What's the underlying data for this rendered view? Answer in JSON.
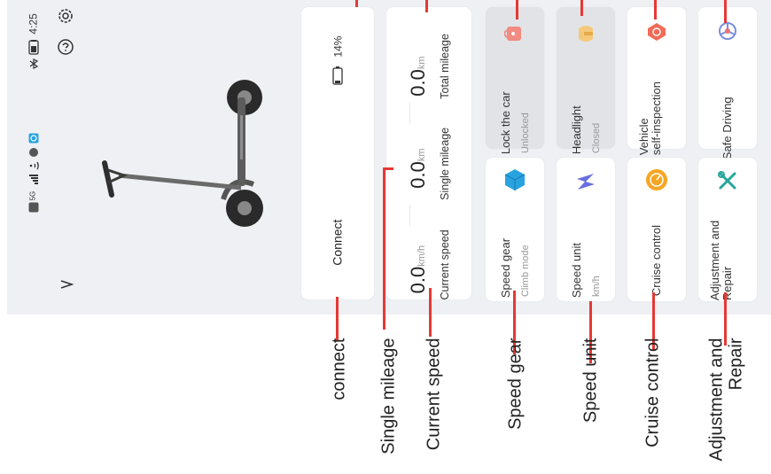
{
  "status_bar": {
    "time": "4:25",
    "network": "5G",
    "icons": [
      "bluetooth-icon",
      "battery-icon",
      "signal-icon",
      "wifi-icon",
      "notification-icon"
    ]
  },
  "header": {
    "icons": [
      "settings-gear-icon",
      "help-icon",
      "chevron-down-icon"
    ]
  },
  "scooter": {
    "image": "electric-scooter"
  },
  "connect_card": {
    "button_label": "Connect",
    "battery_percent": "14%",
    "battery_level": 0.14
  },
  "stats": {
    "total_mileage": {
      "value": "0.0",
      "unit": "km",
      "label": "Total mileage"
    },
    "single_mileage": {
      "value": "0.0",
      "unit": "km",
      "label": "Single mileage"
    },
    "current_speed": {
      "value": "0.0",
      "unit": "km/h",
      "label": "Current speed"
    }
  },
  "controls": {
    "lock": {
      "label": "Lock the car",
      "status": "Unlocked",
      "icon": "lock-icon"
    },
    "headlight": {
      "label": "Headlight",
      "status": "Closed",
      "icon": "headlight-icon"
    },
    "inspection": {
      "label": "Vehicle self-inspection",
      "line1": "Vehicle",
      "line2": "self-inspection",
      "icon": "inspection-icon"
    },
    "safe_driving": {
      "label": "Safe Driving",
      "icon": "safe-driving-icon"
    },
    "speed_gear": {
      "label": "Speed gear",
      "status": "Climb mode",
      "icon": "speed-gear-icon"
    },
    "speed_unit": {
      "label": "Speed unit",
      "status": "km/h",
      "icon": "speed-unit-icon"
    },
    "cruise": {
      "label": "Cruise control",
      "icon": "cruise-control-icon"
    },
    "repair": {
      "label": "Adjustment and Repair",
      "line1": "Adjustment and",
      "line2": "Repair",
      "icon": "repair-tools-icon"
    }
  },
  "annotations": {
    "connect": "connect",
    "single_mileage": "Single mileage",
    "current_speed": "Current speed",
    "speed_gear": "Speed gear",
    "speed_unit": "Speed unit",
    "cruise_control": "Cruise control",
    "adjustment_line1": "Adjustment and",
    "adjustment_line2": "Repair"
  },
  "colors": {
    "annotation_line": "#e53935",
    "lock_icon": "#f28b82",
    "headlight_icon": "#f5c97a",
    "inspection_icon": "#ef6c57",
    "safe_driving_icon": "#7b8fd9",
    "speed_gear_icon": "#29a3e0",
    "speed_unit_icon": "#6a6fe0",
    "cruise_icon": "#f6a623",
    "repair_icon": "#26a69a"
  }
}
